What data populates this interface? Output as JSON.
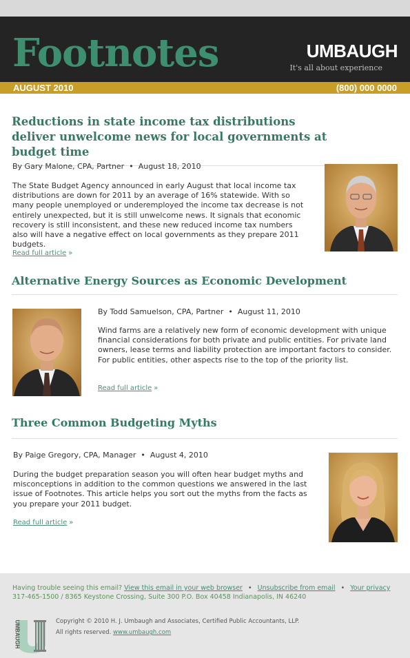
{
  "header": {
    "masthead": "Footnotes",
    "brand": "UMBAUGH",
    "tagline": "It's all about experience",
    "issue_date": "AUGUST 2010",
    "phone": "(800) 000 0000"
  },
  "articles": [
    {
      "title": "Reductions in state income tax distributions deliver unwelcome news for local governments at budget time",
      "byline": "By Gary Malone, CPA, Partner",
      "date": "August 18, 2010",
      "body": "The State Budget Agency announced in early August that local income tax distributions are down for 2011 by an average of 16% statewide.  With so many people unemployed or underemployed the income tax decrease is not entirely unexpected, but it is still unwelcome news.  It signals that economic recovery is still inconsistent, and these new reduced income tax numbers also will have a negative effect on local governments as they prepare 2011 budgets.",
      "link": "Read full article",
      "link_arrow": "»"
    },
    {
      "title": "Alternative Energy Sources as Economic Development",
      "byline": "By Todd Samuelson, CPA, Partner",
      "date": "August 11, 2010",
      "body": "Wind farms are a relatively new form of economic development with unique financial considerations for both private and public entities. For private land owners, lease terms and liability protection are important factors to consider. For public entities, other aspects rise to the top of the priority list.",
      "link": "Read full article",
      "link_arrow": "»"
    },
    {
      "title": "Three Common Budgeting Myths",
      "byline": "By Paige Gregory, CPA, Manager",
      "date": "August 4, 2010",
      "body": "During the budget preparation season you will often hear budget myths and misconceptions in addition to the common questions we answered in the last issue of Footnotes.  This article helps you sort out the myths from the facts as you prepare your 2011 budget.",
      "link": "Read full article",
      "link_arrow": "»"
    }
  ],
  "footer": {
    "trouble": "Having trouble seeing this email?",
    "web_link": "View this email in your web browser",
    "unsubscribe": "Unsubscribe from email",
    "privacy": "Your privacy",
    "separator": "•",
    "address": "317-465-1500 / 8365 Keystone Crossing, Suite 300 P.O. Box 40458 Indianapolis, IN 46240",
    "copyright": "Copyright © 2010  H. J. Umbaugh and Associates, Certified Public Accountants, LLP.",
    "rights": "All rights reserved.",
    "site": "www.umbaugh.com",
    "logo_text": "UMBAUGH"
  },
  "colors": {
    "accent_green": "#367a60",
    "gold": "#c89e28",
    "header_bg": "#242424"
  }
}
